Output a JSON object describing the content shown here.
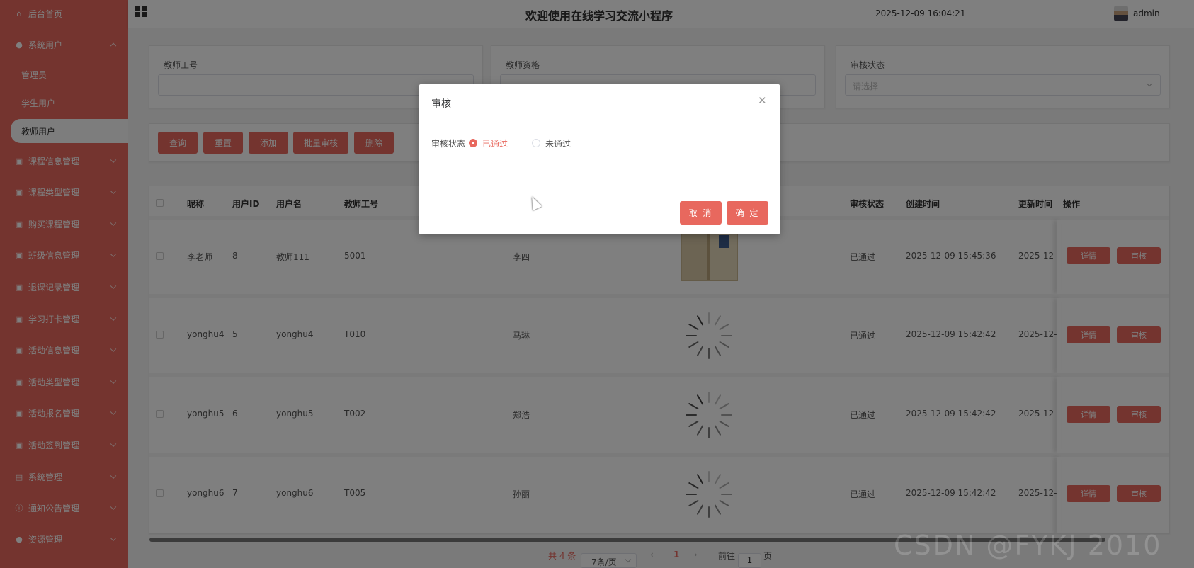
{
  "app": {
    "title": "欢迎使用在线学习交流小程序",
    "datetime": "2025-12-09 16:04:21",
    "user": "admin"
  },
  "colors": {
    "accent": "#e8685e",
    "overlay": "rgba(0,0,0,0.5)"
  },
  "sidebar": {
    "items": [
      {
        "label": "后台首页",
        "icon": "home-icon"
      },
      {
        "label": "系统用户",
        "icon": "user-icon",
        "expanded": true,
        "children": [
          {
            "label": "管理员"
          },
          {
            "label": "学生用户"
          },
          {
            "label": "教师用户",
            "active": true
          }
        ]
      },
      {
        "label": "课程信息管理",
        "icon": "doc-icon"
      },
      {
        "label": "课程类型管理",
        "icon": "doc-icon"
      },
      {
        "label": "购买课程管理",
        "icon": "doc-icon"
      },
      {
        "label": "班级信息管理",
        "icon": "doc-icon"
      },
      {
        "label": "退课记录管理",
        "icon": "doc-icon"
      },
      {
        "label": "学习打卡管理",
        "icon": "doc-icon"
      },
      {
        "label": "活动信息管理",
        "icon": "doc-icon"
      },
      {
        "label": "活动类型管理",
        "icon": "doc-icon"
      },
      {
        "label": "活动报名管理",
        "icon": "doc-icon"
      },
      {
        "label": "活动签到管理",
        "icon": "doc-icon"
      },
      {
        "label": "系统管理",
        "icon": "picture-icon"
      },
      {
        "label": "通知公告管理",
        "icon": "info-icon"
      },
      {
        "label": "资源管理",
        "icon": "dot-icon"
      }
    ]
  },
  "search": {
    "teacher_id_label": "教师工号",
    "qualification_label": "教师资格",
    "status_label": "审核状态",
    "status_placeholder": "请选择"
  },
  "toolbar": {
    "query": "查询",
    "reset": "重置",
    "add": "添加",
    "batch_review": "批量审核",
    "delete": "删除"
  },
  "table": {
    "headers": {
      "nickname": "昵称",
      "user_id": "用户ID",
      "username": "用户名",
      "teacher_id": "教师工号",
      "status": "审核状态",
      "created": "创建时间",
      "updated": "更新时间",
      "actions": "操作"
    },
    "rows": [
      {
        "nickname": "李老师",
        "user_id": "8",
        "username": "教师111",
        "teacher_id": "5001",
        "name": "李四",
        "status": "已通过",
        "created": "2025-12-09 15:45:36",
        "updated": "2025-12-09",
        "has_image": true
      },
      {
        "nickname": "yonghu4",
        "user_id": "5",
        "username": "yonghu4",
        "teacher_id": "T010",
        "name": "马琳",
        "status": "已通过",
        "created": "2025-12-09 15:42:42",
        "updated": "2025-12-09",
        "has_image": false
      },
      {
        "nickname": "yonghu5",
        "user_id": "6",
        "username": "yonghu5",
        "teacher_id": "T002",
        "name": "郑浩",
        "status": "已通过",
        "created": "2025-12-09 15:42:42",
        "updated": "2025-12-09",
        "has_image": false
      },
      {
        "nickname": "yonghu6",
        "user_id": "7",
        "username": "yonghu6",
        "teacher_id": "T005",
        "name": "孙丽",
        "status": "已通过",
        "created": "2025-12-09 15:42:42",
        "updated": "2025-12-09",
        "has_image": false
      }
    ],
    "detail_label": "详情",
    "review_label": "审核"
  },
  "pagination": {
    "total": "共 4 条",
    "page_size": "7条/页",
    "current": "1",
    "goto_prefix": "前往",
    "goto_value": "1",
    "goto_suffix": "页"
  },
  "dialog": {
    "title": "审核",
    "field_label": "审核状态",
    "option_pass": "已通过",
    "option_fail": "未通过",
    "selected": "已通过",
    "cancel": "取 消",
    "confirm": "确 定"
  },
  "watermark": "CSDN @FYKJ 2010"
}
